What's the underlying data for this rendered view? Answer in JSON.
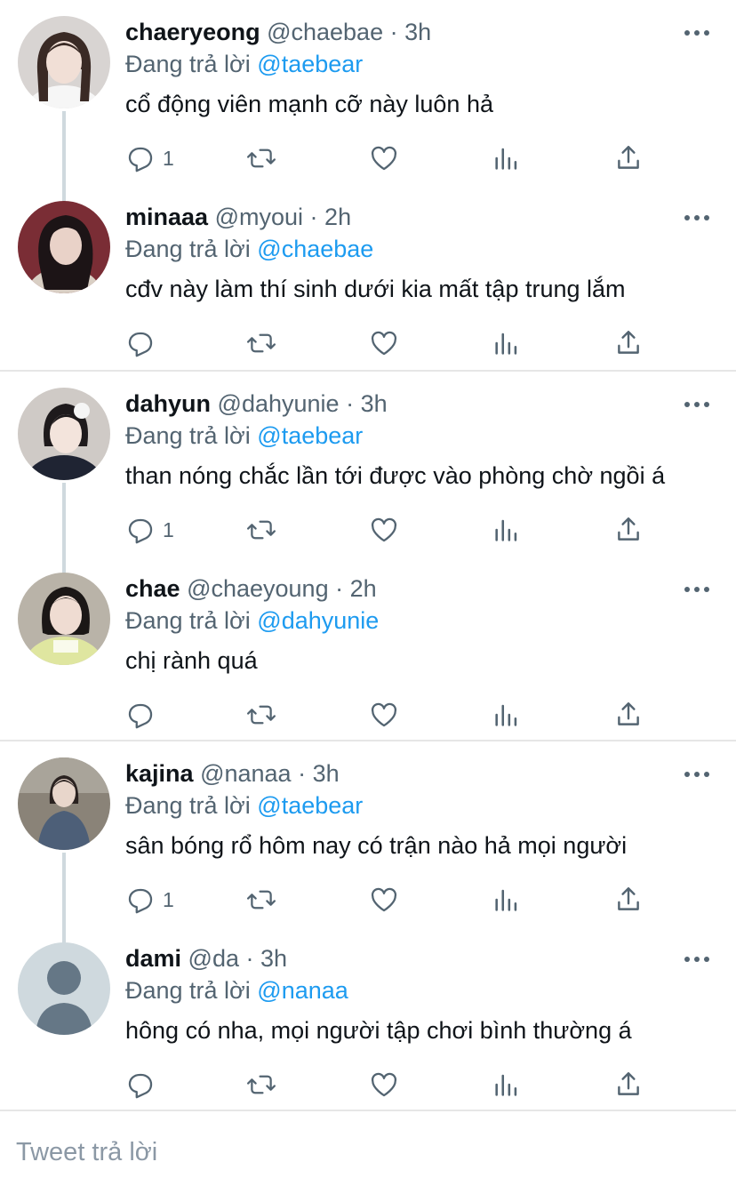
{
  "threads": [
    {
      "tweets": [
        {
          "name": "chaeryeong",
          "handle": "@chaebae",
          "time": "3h",
          "reply_prefix": "Đang trả lời",
          "reply_to": "@taebear",
          "text": "cổ động viên mạnh cỡ này luôn hả",
          "reply_count": "1",
          "avatar": {
            "bg": "#d8d4d2",
            "hair": "#3a2a25",
            "skin": "#f1dfd6",
            "shirt": "#f6f6f6"
          }
        },
        {
          "name": "minaaa",
          "handle": "@myoui",
          "time": "2h",
          "reply_prefix": "Đang trả lời",
          "reply_to": "@chaebae",
          "text": "cđv này làm thí sinh dưới kia mất tập trung lắm",
          "reply_count": "",
          "avatar": {
            "bg": "#7a2d35",
            "hair": "#1c1416",
            "skin": "#e9d2c8",
            "shirt": "#d9cfc4"
          }
        }
      ]
    },
    {
      "tweets": [
        {
          "name": "dahyun",
          "handle": "@dahyunie",
          "time": "3h",
          "reply_prefix": "Đang trả lời",
          "reply_to": "@taebear",
          "text": "than nóng chắc lần tới được vào phòng chờ ngồi á",
          "reply_count": "1",
          "avatar": {
            "bg": "#cfcac6",
            "hair": "#1e1a1c",
            "skin": "#f3e4dc",
            "shirt": "#1f2433"
          }
        },
        {
          "name": "chae",
          "handle": "@chaeyoung",
          "time": "2h",
          "reply_prefix": "Đang trả lời",
          "reply_to": "@dahyunie",
          "text": "chị rành quá",
          "reply_count": "",
          "avatar": {
            "bg": "#b9b3a8",
            "hair": "#1b1716",
            "skin": "#efdcd2",
            "shirt": "#dfe6a0"
          }
        }
      ]
    },
    {
      "tweets": [
        {
          "name": "kajina",
          "handle": "@nanaa",
          "time": "3h",
          "reply_prefix": "Đang trả lời",
          "reply_to": "@taebear",
          "text": "sân bóng rổ hôm nay có trận nào hả mọi người",
          "reply_count": "1",
          "avatar": {
            "bg": "#8a8378",
            "hair": "#2a2220",
            "skin": "#e8d6cb",
            "shirt": "#4d5f78"
          }
        },
        {
          "name": "dami",
          "handle": "@da",
          "time": "3h",
          "reply_prefix": "Đang trả lời",
          "reply_to": "@nanaa",
          "text": "hông có nha, mọi người tập chơi bình thường á",
          "reply_count": "",
          "avatar": {
            "bg": "#cfd9de",
            "hair": "#657786",
            "skin": "#657786",
            "shirt": "#657786",
            "default": true
          }
        }
      ]
    }
  ],
  "compose": {
    "placeholder": "Tweet trả lời"
  },
  "icons": {
    "reply": "reply-icon",
    "retweet": "retweet-icon",
    "like": "heart-icon",
    "views": "analytics-icon",
    "share": "share-icon",
    "more": "more-icon"
  },
  "colors": {
    "accent": "#1d9bf0",
    "muted": "#536471",
    "line": "#cfd9de"
  }
}
